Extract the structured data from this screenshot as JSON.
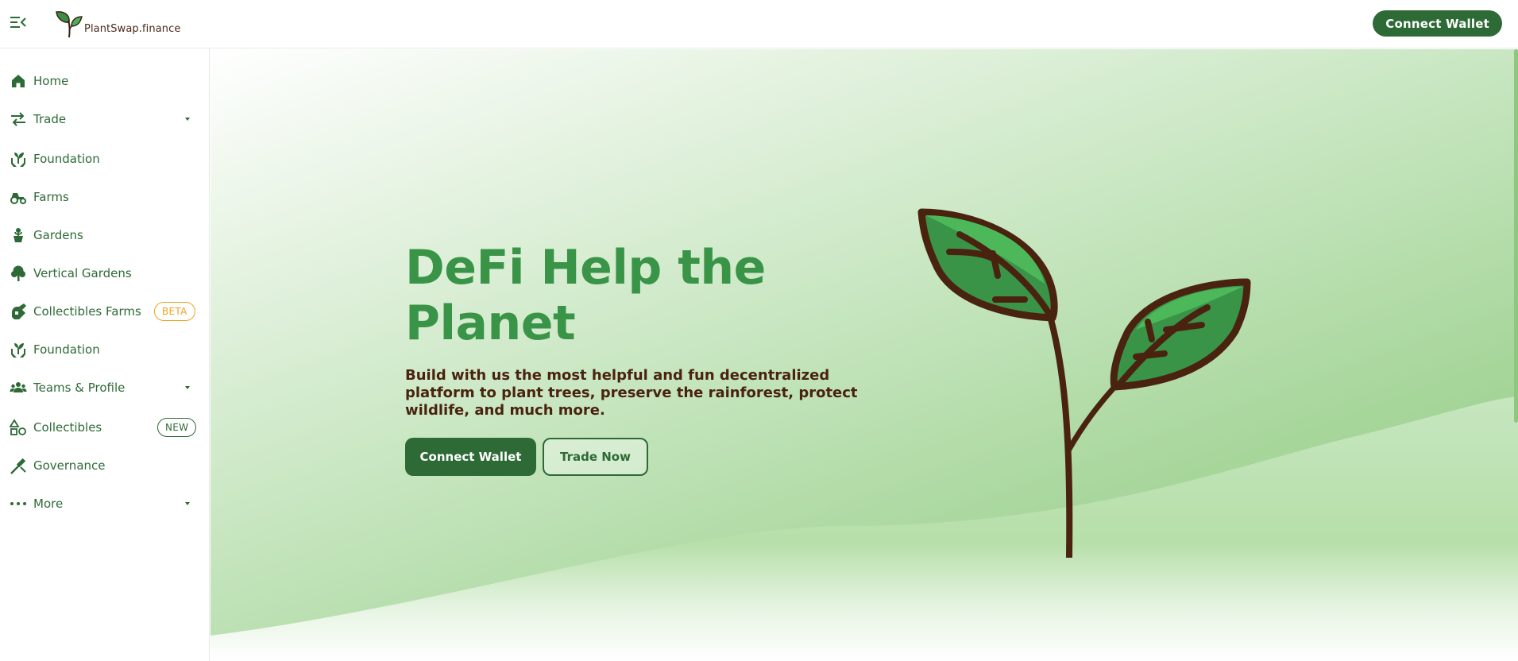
{
  "header": {
    "logo_text": "PlantSwap.finance",
    "connect_label": "Connect Wallet"
  },
  "sidebar": {
    "items": [
      {
        "label": "Home",
        "icon": "home-icon",
        "has_caret": false
      },
      {
        "label": "Trade",
        "icon": "trade-arrows-icon",
        "has_caret": true
      },
      {
        "label": "Foundation",
        "icon": "plant-hands-icon",
        "has_caret": false
      },
      {
        "label": "Farms",
        "icon": "tractor-icon",
        "has_caret": false
      },
      {
        "label": "Gardens",
        "icon": "potted-plant-icon",
        "has_caret": false
      },
      {
        "label": "Vertical Gardens",
        "icon": "tree-icon",
        "has_caret": false
      },
      {
        "label": "Collectibles Farms",
        "icon": "watering-can-icon",
        "badge": "BETA"
      },
      {
        "label": "Foundation",
        "icon": "plant-hands-icon",
        "has_caret": false
      },
      {
        "label": "Teams & Profile",
        "icon": "team-icon",
        "has_caret": true
      },
      {
        "label": "Collectibles",
        "icon": "shapes-icon",
        "badge": "NEW"
      },
      {
        "label": "Governance",
        "icon": "gavel-icon",
        "has_caret": false
      },
      {
        "label": "More",
        "icon": "more-dots-icon",
        "has_caret": true
      }
    ]
  },
  "hero": {
    "title": "DeFi Help the Planet",
    "subtitle": "Build with us the most helpful and fun decentralized platform to plant trees, preserve the rainforest, protect wildlife, and much more.",
    "primary_label": "Connect Wallet",
    "secondary_label": "Trade Now"
  },
  "colors": {
    "brand_green": "#2d6a35",
    "title_green": "#3a9448",
    "beta_orange": "#f0a21b",
    "stem_brown": "#4a2310"
  }
}
